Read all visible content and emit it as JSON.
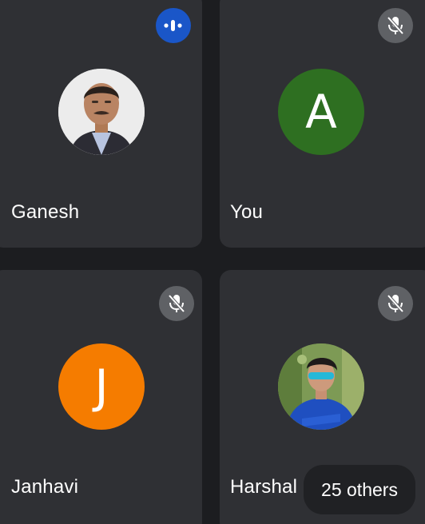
{
  "participants": [
    {
      "name": "Ganesh",
      "status": "speaking",
      "avatar": "photo"
    },
    {
      "name": "You",
      "status": "muted",
      "avatar": "A",
      "avatar_color": "#2e6f21"
    },
    {
      "name": "Janhavi",
      "status": "muted",
      "avatar": "J",
      "avatar_color": "#f57c00"
    },
    {
      "name": "Harshal",
      "status": "muted",
      "avatar": "photo"
    }
  ],
  "others_label": "25 others",
  "icons": {
    "speaking": "audio-wave-icon",
    "muted": "mic-off-icon"
  },
  "colors": {
    "tile": "#2f3034",
    "background": "#1c1d20",
    "speaking_badge": "#1a56c8",
    "muted_badge": "#5f6165"
  }
}
